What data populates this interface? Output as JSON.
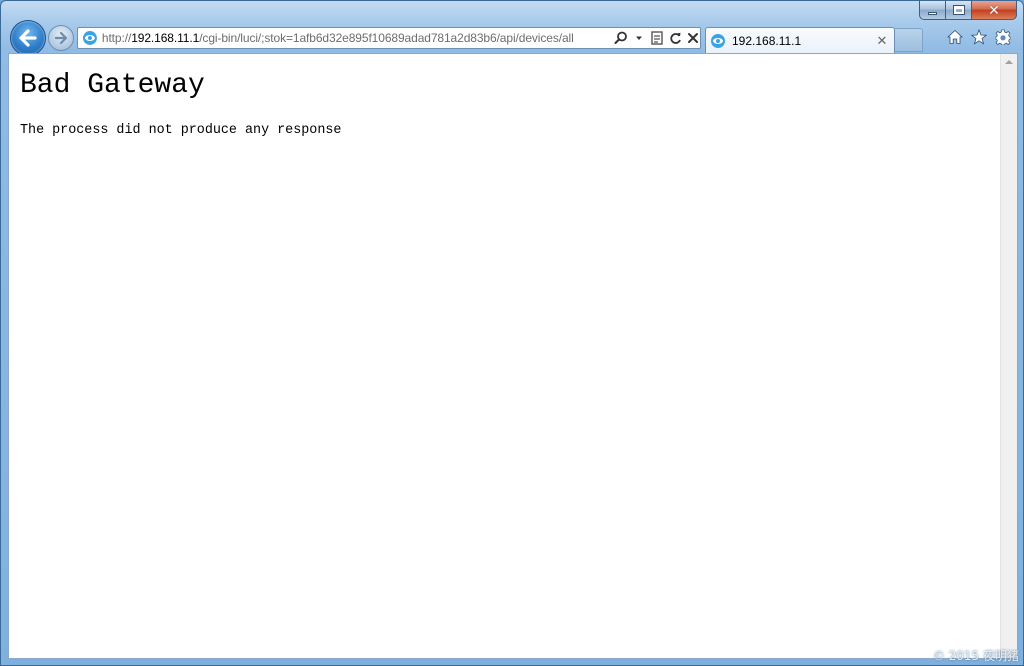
{
  "window": {
    "caption": {
      "minimize_icon": "minimize-icon",
      "maximize_icon": "maximize-icon",
      "close_glyph": "✕"
    }
  },
  "navigation": {
    "back_icon": "back-arrow-icon",
    "forward_icon": "forward-arrow-icon"
  },
  "address_bar": {
    "url_prefix": "http://",
    "url_host": "192.168.11.1",
    "url_path": "/cgi-bin/luci/;stok=1afb6d32e895f10689adad781a2d83b6/api/devices/all",
    "tools": [
      "search-icon",
      "dropdown-icon",
      "compatibility-icon",
      "refresh-icon",
      "stop-icon"
    ]
  },
  "tab": {
    "title": "192.168.11.1",
    "close_glyph": "✕"
  },
  "toolbar": {
    "icons": [
      "home-icon",
      "favorites-star-icon",
      "settings-gear-icon"
    ]
  },
  "page": {
    "heading": "Bad Gateway",
    "message": "The process did not produce any response"
  },
  "watermark": "© 2015 夜明猪",
  "colors": {
    "frame": "#8fbbe4",
    "accent_blue": "#2f7cc8",
    "close_red": "#c2401d"
  }
}
